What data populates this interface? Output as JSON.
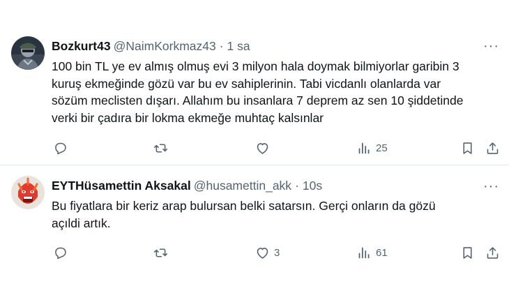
{
  "tweets": [
    {
      "name": "Bozkurt43",
      "handle": "@NaimKorkmaz43",
      "separator": "·",
      "time": "1 sa",
      "text": "100 bin TL ye ev almış olmuş evi 3 milyon hala doymak bilmiyorlar garibin 3\nkuruş ekmeğinde gözü var bu ev sahiplerinin. Tabi vicdanlı olanlarda var\nsözüm meclisten dışarı. Allahım bu insanlara 7 deprem az sen 10 şiddetinde\nverki bir çadıra bir lokma ekmeğe muhtaç kalsınlar",
      "more": "···",
      "stats": {
        "replies": "",
        "retweets": "",
        "likes": "",
        "views": "25"
      },
      "icons": [
        "reply-icon",
        "retweet-icon",
        "like-icon",
        "views-icon",
        "bookmark-icon",
        "share-icon"
      ]
    },
    {
      "name": "EYTHüsamettin Aksakal",
      "handle": "@husamettin_akk",
      "separator": "·",
      "time": "10s",
      "text": "Bu  fiyatlara bir keriz arap bulursan belki satarsın. Gerçi onların da gözü\naçıldi artık.",
      "more": "···",
      "stats": {
        "replies": "",
        "retweets": "",
        "likes": "3",
        "views": "61"
      },
      "icons": [
        "reply-icon",
        "retweet-icon",
        "like-icon",
        "views-icon",
        "bookmark-icon",
        "share-icon"
      ]
    }
  ],
  "colors": {
    "text": "#0f1419",
    "secondary": "#536471",
    "divider": "#e1e7eb",
    "background": "#ffffff"
  }
}
